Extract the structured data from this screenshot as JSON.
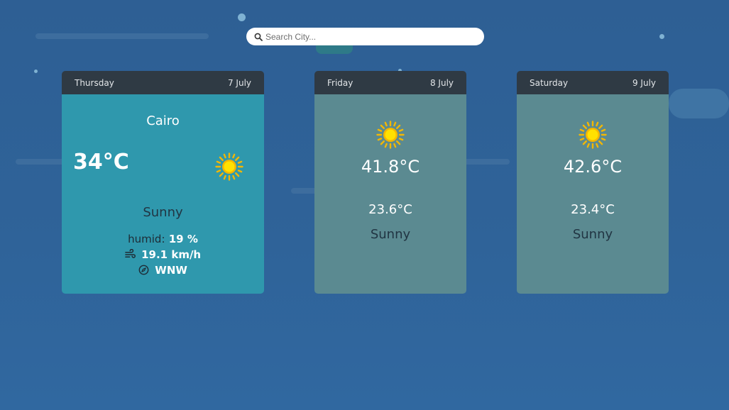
{
  "search": {
    "placeholder": "Search City..."
  },
  "today": {
    "day": "Thursday",
    "date": "7 July",
    "city": "Cairo",
    "temperature": "34°C",
    "condition": "Sunny",
    "humidity_label": "humid:",
    "humidity_value": "19 %",
    "wind_speed": "19.1 km/h",
    "wind_direction": "WNW",
    "icon": "sun-icon"
  },
  "forecast": [
    {
      "day": "Friday",
      "date": "8 July",
      "max_temp": "41.8°C",
      "min_temp": "23.6°C",
      "condition": "Sunny",
      "icon": "sun-icon"
    },
    {
      "day": "Saturday",
      "date": "9 July",
      "max_temp": "42.6°C",
      "min_temp": "23.4°C",
      "condition": "Sunny",
      "icon": "sun-icon"
    }
  ],
  "colors": {
    "background": "#2e5f94",
    "today_card": "#2f98ad",
    "forecast_card": "#5b8a91",
    "card_header": "#2f3a44",
    "sun": "#f5c400"
  }
}
